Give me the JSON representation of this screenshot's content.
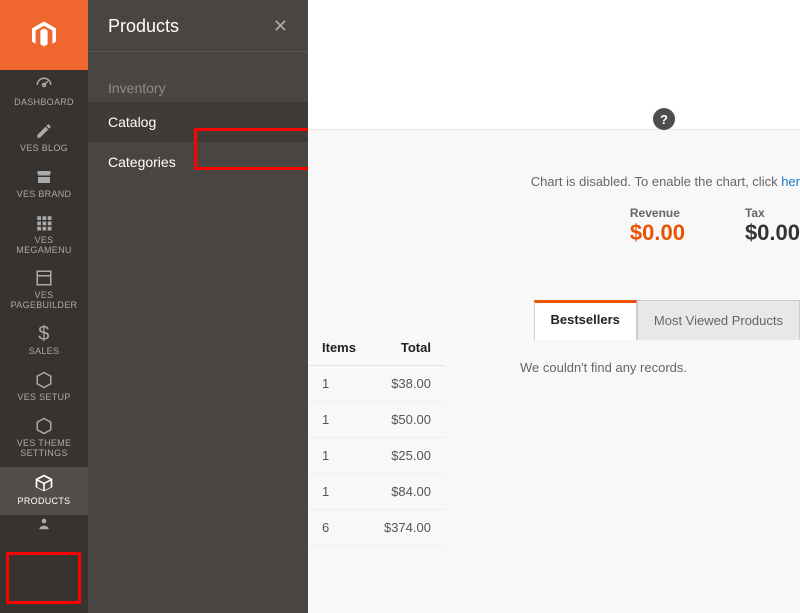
{
  "rail": {
    "items": [
      {
        "key": "dashboard",
        "label": "DASHBOARD"
      },
      {
        "key": "ves-blog",
        "label": "VES BLOG"
      },
      {
        "key": "ves-brand",
        "label": "VES BRAND"
      },
      {
        "key": "ves-megamenu",
        "label": "VES\nMEGAMENU"
      },
      {
        "key": "ves-pagebuilder",
        "label": "VES\nPAGEBUILDER"
      },
      {
        "key": "sales",
        "label": "SALES"
      },
      {
        "key": "ves-setup",
        "label": "VES SETUP"
      },
      {
        "key": "ves-theme-settings",
        "label": "VES THEME\nSETTINGS"
      },
      {
        "key": "products",
        "label": "PRODUCTS",
        "active": true
      }
    ]
  },
  "submenu": {
    "title": "Products",
    "group": "Inventory",
    "links": {
      "catalog": "Catalog",
      "categories": "Categories"
    }
  },
  "dashboard": {
    "chart_disabled_prefix": "Chart is disabled. To enable the chart, click ",
    "chart_disabled_link": "her",
    "revenue_label": "Revenue",
    "revenue_value": "$0.00",
    "tax_label": "Tax",
    "tax_value": "$0.00",
    "tabs": {
      "bestsellers": "Bestsellers",
      "most_viewed": "Most Viewed Products"
    },
    "no_records": "We couldn't find any records.",
    "orders_table": {
      "headers": {
        "items": "Items",
        "total": "Total"
      },
      "rows": [
        {
          "items": "1",
          "total": "$38.00"
        },
        {
          "items": "1",
          "total": "$50.00"
        },
        {
          "items": "1",
          "total": "$25.00"
        },
        {
          "items": "1",
          "total": "$84.00"
        },
        {
          "items": "6",
          "total": "$374.00"
        }
      ]
    }
  }
}
